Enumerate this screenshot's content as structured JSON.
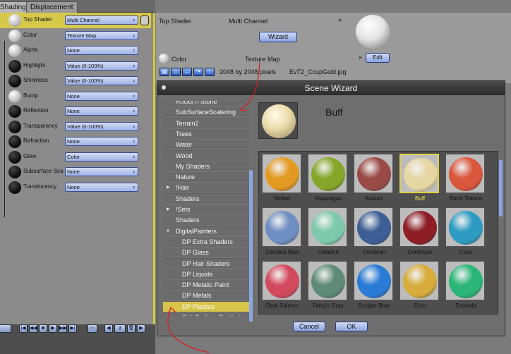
{
  "tabs": [
    "Shading",
    "Displacement"
  ],
  "channels": [
    {
      "label": "Top Shader",
      "value": "Multi Channel",
      "ball": "w"
    },
    {
      "label": "Color",
      "value": "Texture Map",
      "ball": "w"
    },
    {
      "label": "Alpha",
      "value": "None",
      "ball": "w"
    },
    {
      "label": "Highlight",
      "value": "Value (0-100%)",
      "ball": "b"
    },
    {
      "label": "Shininess",
      "value": "Value (0-100%)",
      "ball": "b"
    },
    {
      "label": "Bump",
      "value": "None",
      "ball": "w"
    },
    {
      "label": "Reflection",
      "value": "None",
      "ball": "b"
    },
    {
      "label": "Transparency",
      "value": "Value (0-100%)",
      "ball": "b"
    },
    {
      "label": "Refraction",
      "value": "None",
      "ball": "b"
    },
    {
      "label": "Glow",
      "value": "Color",
      "ball": "b"
    },
    {
      "label": "Subsurface Sca",
      "value": "None",
      "ball": "b"
    },
    {
      "label": "Translucency",
      "value": "None",
      "ball": "b"
    }
  ],
  "shader_panel": {
    "top_label": "Top Shader",
    "top_value": "Multi Channel",
    "wizard": "Wizard",
    "color_label": "Color",
    "color_value": "Texture Map",
    "edit": "Edit",
    "size": "2048 by 2048 pixels",
    "file": "EvT2_CcupGold.jpg"
  },
  "dialog": {
    "title": "Scene Wizard",
    "preview_name": "Buff",
    "cancel": "Cancel",
    "ok": "OK",
    "list": [
      {
        "label": "Rocks n Stone",
        "type": "item"
      },
      {
        "label": "SubSurfaceScatering",
        "type": "item"
      },
      {
        "label": "Terrain2",
        "type": "item"
      },
      {
        "label": "Trees",
        "type": "item"
      },
      {
        "label": "Water",
        "type": "item"
      },
      {
        "label": "Wood",
        "type": "item"
      },
      {
        "label": "My Shaders",
        "type": "item"
      },
      {
        "label": "Nature",
        "type": "item"
      },
      {
        "label": "!Hair",
        "type": "folder"
      },
      {
        "label": "Shaders",
        "type": "item"
      },
      {
        "label": "!Sets",
        "type": "folder"
      },
      {
        "label": "Shaders",
        "type": "item"
      },
      {
        "label": "DigitalPainters",
        "type": "open"
      },
      {
        "label": "DP Extra Shaders",
        "type": "child"
      },
      {
        "label": "DP Glass",
        "type": "child"
      },
      {
        "label": "DP Hair Shaders",
        "type": "child"
      },
      {
        "label": "DP Liquids",
        "type": "child"
      },
      {
        "label": "DP Metalic Paint",
        "type": "child"
      },
      {
        "label": "DP Metals",
        "type": "child"
      },
      {
        "label": "DP Plastics",
        "type": "child-sel"
      },
      {
        "label": "Sub Surface Scattering",
        "type": "child-folder"
      }
    ],
    "swatches": [
      {
        "name": "Amber",
        "color": "#e39a22"
      },
      {
        "name": "Asparagus",
        "color": "#86a629"
      },
      {
        "name": "Auburn",
        "color": "#9a4a46"
      },
      {
        "name": "Buff",
        "color": "#e6d6a2",
        "selected": true
      },
      {
        "name": "Burnt Sienna",
        "color": "#d9573c"
      },
      {
        "name": "Carolina Blue",
        "color": "#6f8ec2"
      },
      {
        "name": "Celadon",
        "color": "#7ec9ad"
      },
      {
        "name": "Cerulean",
        "color": "#3d5f96"
      },
      {
        "name": "Cordovan",
        "color": "#8e1d26"
      },
      {
        "name": "Cyan",
        "color": "#2e9cc2"
      },
      {
        "name": "Dark Salmon",
        "color": "#d24b5d"
      },
      {
        "name": "Davy's Gray",
        "color": "#5f8a79"
      },
      {
        "name": "Dodger Blue",
        "color": "#2a7bd6"
      },
      {
        "name": "Ecru",
        "color": "#d7ac3c"
      },
      {
        "name": "Emerald",
        "color": "#2bb678"
      }
    ]
  },
  "colors": {
    "accent": "#d6c94a",
    "button": "#9fb3e6",
    "annotation": "#d42020"
  }
}
